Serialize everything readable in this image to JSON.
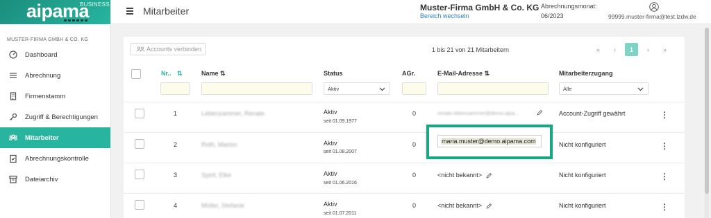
{
  "app": {
    "logo": "aipama",
    "logo_badge": "BUSINESS",
    "company_label": "MUSTER-FIRMA GMBH & CO. KG"
  },
  "sidebar": {
    "items": [
      {
        "label": "Dashboard",
        "icon": "dashboard-icon",
        "active": false
      },
      {
        "label": "Abrechnung",
        "icon": "list-icon",
        "active": false
      },
      {
        "label": "Firmenstamm",
        "icon": "building-icon",
        "active": false
      },
      {
        "label": "Zugriff & Berechtigungen",
        "icon": "key-icon",
        "active": false
      },
      {
        "label": "Mitarbeiter",
        "icon": "users-icon",
        "active": true
      },
      {
        "label": "Abrechnungskontrolle",
        "icon": "clipboard-check-icon",
        "active": false
      },
      {
        "label": "Dateiarchiv",
        "icon": "archive-icon",
        "active": false
      }
    ]
  },
  "header": {
    "title": "Mitarbeiter",
    "company": "Muster-Firma GmbH & Co. KG",
    "switch_area": "Bereich wechseln",
    "period_label": "Abrechnungsmonat:",
    "period_value": "06/2023",
    "user_email": "99999.muster-firma@test.lzdw.de"
  },
  "toolbar": {
    "connect_accounts": "Accounts verbinden",
    "count_text": "1 bis 21 von 21 Mitarbeitern",
    "pager": [
      "«",
      "‹",
      "1",
      "›",
      "»"
    ]
  },
  "table": {
    "headers": {
      "nr": "Nr..",
      "name": "Name ⇅",
      "status": "Status",
      "agr": "AGr.",
      "email": "E-Mail-Adresse ⇅",
      "access": "Mitarbeiterzugang"
    },
    "filters": {
      "status": "Aktiv",
      "access": "Alle"
    },
    "rows": [
      {
        "nr": "1",
        "name": "Lebenzammer, Renate",
        "status": "Aktiv",
        "since": "seit 01.09.1977",
        "agr": "0",
        "email": "renate.lebenzammer@demo.aipa…",
        "access": "Account-Zugriff gewährt"
      },
      {
        "nr": "2",
        "name": "Roth, Marion",
        "status": "Aktiv",
        "since": "seit 01.08.2007",
        "agr": "0",
        "email": "maria.muster@demo.aipama.com",
        "access": "Nicht konfiguriert"
      },
      {
        "nr": "3",
        "name": "Spirit, Elke",
        "status": "Aktiv",
        "since": "seit 01.06.2016",
        "agr": "0",
        "email": "<nicht bekannt>",
        "access": "Nicht konfiguriert"
      },
      {
        "nr": "4",
        "name": "Müller, Stefanie",
        "status": "Aktiv",
        "since": "seit 01.07.2011",
        "agr": "0",
        "email": "<nicht bekannt>",
        "access": "Nicht konfiguriert"
      }
    ]
  },
  "colors": {
    "accent": "#27b59f",
    "highlight_border": "#19a684",
    "link": "#2a83c8"
  }
}
